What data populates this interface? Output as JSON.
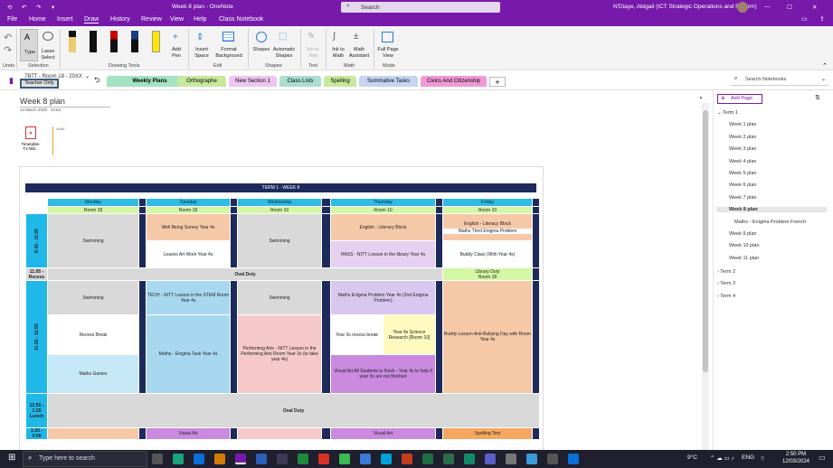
{
  "titlebar": {
    "title": "Week 8 plan",
    "app": "OneNote",
    "search_placeholder": "Search",
    "user": "N'Diaye, Abigail (ICT Strategic Operations and Reform)"
  },
  "menu": [
    "File",
    "Home",
    "Insert",
    "Draw",
    "History",
    "Review",
    "View",
    "Help",
    "Class Notebook"
  ],
  "ribbon": {
    "buttons": {
      "undo": "Undo",
      "type": "Type",
      "lasso": "Lasso Select",
      "add_pen": "Add Pen",
      "insert_space": "Insert Space",
      "format_bg": "Format Background",
      "shapes": "Shapes",
      "auto_shapes": "Automatic Shapes",
      "ink_text": "Ink to Text",
      "ink_math": "Ink to Math",
      "math_asst": "Math Assistant",
      "full_page": "Full Page View"
    },
    "groups": {
      "undo": "Undo",
      "selection": "Selection",
      "tools": "Drawing Tools",
      "edit": "Edit",
      "shapes": "Shapes",
      "text": "Text",
      "math": "Math",
      "mode": "Mode"
    }
  },
  "notebook": {
    "name": "7B7T - Room 18 - 20XX",
    "teacher_only": "Teacher Only"
  },
  "sections": [
    "Weekly Plans",
    "Orthographe",
    "New Section 1",
    "Class Lists",
    "Spelling",
    "Summative Tasks",
    "Civics And Citizenship"
  ],
  "page": {
    "title": "Week 8 plan",
    "date": "14 March 2020",
    "time": "13:54",
    "attachment": "Timetable-T1-W8...",
    "attachment_ext": "pdf"
  },
  "timetable": {
    "banner": "TERM 1 - WEEK 8",
    "days": [
      "Monday",
      "Tuesday",
      "Wednesday",
      "Thursday",
      "Friday"
    ],
    "rooms": [
      "Room 18",
      "Room 18",
      "Room 10",
      "Room 10",
      "Room 10"
    ],
    "times": {
      "t1": "8:45 - 11:05",
      "t2": "11:05 - Recess",
      "t3": "11:25 - 12:55",
      "t4": "12:55 - 1:25 Lunch",
      "t5": "1:25 - 3:00"
    },
    "cells": {
      "mon1": "Swimming",
      "tue1a": "Well Being Survey Year 4s",
      "tue1b": "Leaves Art Work Year 4s",
      "wed1": "Swimming",
      "thu1a": "English - Literacy Block",
      "thu1b": "HASS - NITT Lesson in the library Year 4s",
      "fri1a": "English - Literacy Block",
      "fri1b": "Maths Third Enigma Problem",
      "fri1c": "Buddy Class (With Year 4s)",
      "oval": "Oval Duty",
      "fri_lib": "Library Duty",
      "fri_lib_room": "Room 18",
      "mon2": "Swimming",
      "tue2a": "TECH - NITT Lesson in the STEM Room Year 4s",
      "wed2": "Swimming",
      "thu2": "Maths Enigma Problem Year 4s (2nd Enigma Problem)",
      "fri2": "Buddy Lesson Anti-Bullying Day with Room Year 4s",
      "mon3": "Recess Break",
      "tue3": "Maths - Enigma Task Year 4s",
      "wed3": "Performing Arts - NITT Lesson in the Performing Arts Room Year 3s (to take year 4s)",
      "thu3a": "Year 3s recess break",
      "thu3b": "Year 4s Science Research [Room 10]",
      "mon4": "Maths Games",
      "thu4": "Visual Art All Students to finish - Year 4s to help if year 3s are not finished",
      "oval2": "Oval Duty",
      "tue5": "Visual Art",
      "thu5": "Visual Art",
      "fri5": "Spelling Test"
    }
  },
  "right_panel": {
    "search_placeholder": "Search Notebooks",
    "add_page": "Add Page",
    "items": [
      {
        "label": "Term 1",
        "level": 0,
        "expanded": true
      },
      {
        "label": "Week 1 plan",
        "level": 1
      },
      {
        "label": "Week 2 plan",
        "level": 1
      },
      {
        "label": "Week 3 plan",
        "level": 1
      },
      {
        "label": "Week 4 plan",
        "level": 1
      },
      {
        "label": "Week 5 plan",
        "level": 1
      },
      {
        "label": "Week 6 plan",
        "level": 1
      },
      {
        "label": "Week 7 plan",
        "level": 1
      },
      {
        "label": "Week 8 plan",
        "level": 1,
        "selected": true
      },
      {
        "label": "Maths - Enigma Problem French",
        "level": 2
      },
      {
        "label": "Week 9 plan",
        "level": 1
      },
      {
        "label": "Week 10 plan",
        "level": 1
      },
      {
        "label": "Week 11 plan",
        "level": 1
      },
      {
        "label": "Term 2",
        "level": 0
      },
      {
        "label": "Term 3",
        "level": 0
      },
      {
        "label": "Term 4",
        "level": 0
      }
    ]
  },
  "taskbar": {
    "search_placeholder": "Type here to search",
    "temp": "9°C",
    "lang": "ENG",
    "time": "2:50 PM",
    "date": "12/03/2024"
  },
  "colors": {
    "accent": "#7719aa",
    "time_col": "#1fb8e8",
    "day_header": "#2ebbe4",
    "room_row": "#d4f7a4",
    "navy": "#1d2b5c"
  }
}
